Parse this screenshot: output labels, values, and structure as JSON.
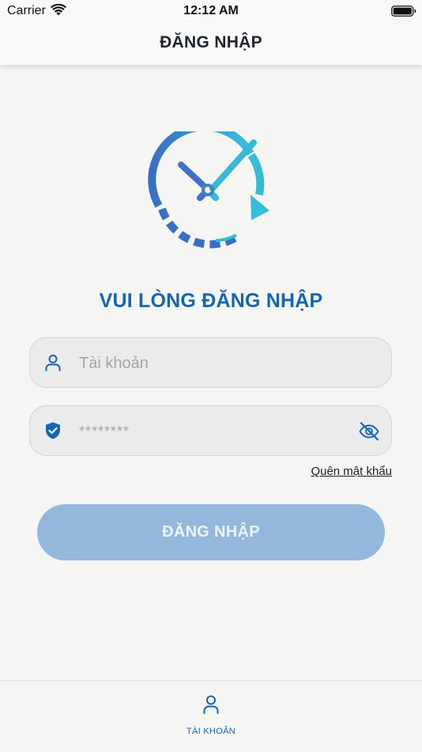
{
  "status_bar": {
    "carrier": "Carrier",
    "time": "12:12 AM",
    "icons": [
      "wifi-icon",
      "battery-icon"
    ]
  },
  "nav": {
    "title": "ĐĂNG NHẬP"
  },
  "logo": {
    "icon": "clock-refresh-icon",
    "gradient": [
      "#3a6fc4",
      "#36c0d6"
    ]
  },
  "heading": "VUI LÒNG ĐĂNG NHẬP",
  "form": {
    "username": {
      "icon": "user-icon",
      "placeholder": "Tài khoản",
      "value": ""
    },
    "password": {
      "icon": "shield-check-icon",
      "placeholder": "********",
      "value": "",
      "toggle_icon": "eye-off-icon"
    },
    "forgot_password": "Quên mật khẩu",
    "submit_label": "ĐĂNG NHẬP"
  },
  "tab_bar": {
    "items": [
      {
        "label": "TÀI KHOẢN",
        "icon": "user-icon",
        "active": true
      }
    ]
  },
  "colors": {
    "brand": "#1565b5",
    "button_disabled": "#94b7dc",
    "background": "#f5f5f4",
    "input_bg": "#ebebeb"
  }
}
